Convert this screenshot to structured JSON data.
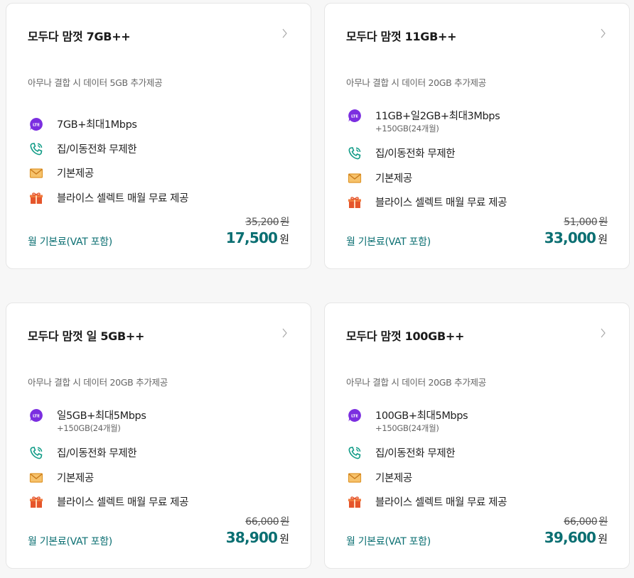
{
  "colors": {
    "accent": "#0b6f72",
    "lte": "#7b2ee0",
    "phone": "#0f9b86",
    "mail": "#f0a43a",
    "gift": "#e5552b"
  },
  "icons": {
    "data": "lte-icon",
    "call": "phone-icon",
    "message": "mail-icon",
    "benefit": "gift-icon",
    "more": "chevron-right-icon"
  },
  "lte_label": "LTE",
  "plans": [
    {
      "title": "모두다 맘껏 7GB++",
      "subtitle": "아무나 결합 시 데이터 5GB 추가제공",
      "data_main": "7GB+최대1Mbps",
      "data_sub": "",
      "calls": "집/이동전화 무제한",
      "messages": "기본제공",
      "benefit": "블라이스 셀렉트 매월 무료 제공",
      "original_price": "35,200",
      "price_label": "월 기본료(VAT 포함)",
      "price": "17,500",
      "currency": "원"
    },
    {
      "title": "모두다 맘껏 11GB++",
      "subtitle": "아무나 결합 시 데이터 20GB 추가제공",
      "data_main": "11GB+일2GB+최대3Mbps",
      "data_sub": "+150GB(24개월)",
      "calls": "집/이동전화 무제한",
      "messages": "기본제공",
      "benefit": "블라이스 셀렉트 매월 무료 제공",
      "original_price": "51,000",
      "price_label": "월 기본료(VAT 포함)",
      "price": "33,000",
      "currency": "원"
    },
    {
      "title": "모두다 맘껏 일 5GB++",
      "subtitle": "아무나 결합 시 데이터 20GB 추가제공",
      "data_main": "일5GB+최대5Mbps",
      "data_sub": "+150GB(24개월)",
      "calls": "집/이동전화 무제한",
      "messages": "기본제공",
      "benefit": "블라이스 셀렉트 매월 무료 제공",
      "original_price": "66,000",
      "price_label": "월 기본료(VAT 포함)",
      "price": "38,900",
      "currency": "원"
    },
    {
      "title": "모두다 맘껏 100GB++",
      "subtitle": "아무나 결합 시 데이터 20GB 추가제공",
      "data_main": "100GB+최대5Mbps",
      "data_sub": "+150GB(24개월)",
      "calls": "집/이동전화 무제한",
      "messages": "기본제공",
      "benefit": "블라이스 셀렉트 매월 무료 제공",
      "original_price": "66,000",
      "price_label": "월 기본료(VAT 포함)",
      "price": "39,600",
      "currency": "원"
    }
  ]
}
